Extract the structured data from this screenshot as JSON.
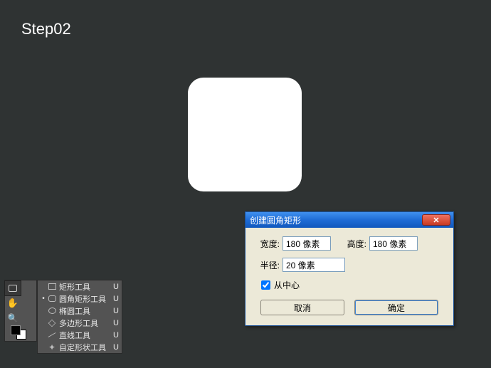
{
  "step_label": "Step02",
  "tool_flyout": {
    "items": [
      {
        "label": "矩形工具",
        "shortcut": "U",
        "icon": "rect",
        "selected": false
      },
      {
        "label": "圆角矩形工具",
        "shortcut": "U",
        "icon": "rounded-rect",
        "selected": true
      },
      {
        "label": "椭圆工具",
        "shortcut": "U",
        "icon": "ellipse",
        "selected": false
      },
      {
        "label": "多边形工具",
        "shortcut": "U",
        "icon": "polygon",
        "selected": false
      },
      {
        "label": "直线工具",
        "shortcut": "U",
        "icon": "line",
        "selected": false
      },
      {
        "label": "自定形状工具",
        "shortcut": "U",
        "icon": "custom-shape",
        "selected": false
      }
    ]
  },
  "dialog": {
    "title": "创建圆角矩形",
    "width_label": "宽度:",
    "width_value": "180 像素",
    "height_label": "高度:",
    "height_value": "180 像素",
    "radius_label": "半径:",
    "radius_value": "20 像素",
    "center_label": "从中心",
    "center_checked": true,
    "cancel_label": "取消",
    "ok_label": "确定"
  }
}
